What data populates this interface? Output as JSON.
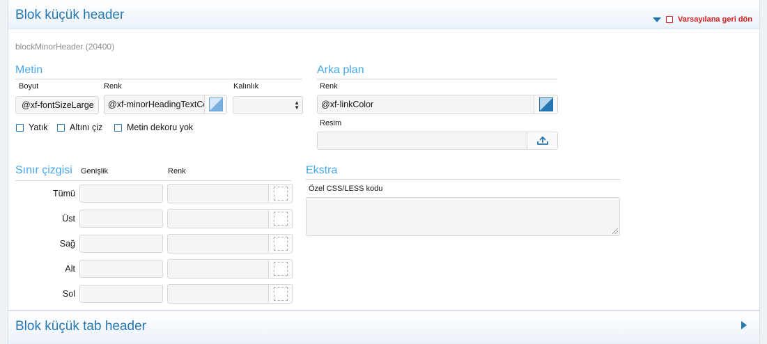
{
  "top_block": {
    "title": "Blok küçük header",
    "reset_label": "Varsayılana geri dön",
    "subtitle": "blockMinorHeader (20400)"
  },
  "metin": {
    "title": "Metin",
    "size_label": "Boyut",
    "size_value": "@xf-fontSizeLarge",
    "color_label": "Renk",
    "color_value": "@xf-minorHeadingTextColor",
    "weight_label": "Kalınlık",
    "weight_value": "",
    "checkboxes": [
      "Yatık",
      "Altını çiz",
      "Metin dekoru yok"
    ]
  },
  "arka_plan": {
    "title": "Arka plan",
    "color_label": "Renk",
    "color_value": "@xf-linkColor",
    "image_label": "Resim",
    "image_value": ""
  },
  "sinir": {
    "title": "Sınır çizgisi",
    "width_header": "Genişlik",
    "color_header": "Renk",
    "rows": [
      "Tümü",
      "Üst",
      "Sağ",
      "Alt",
      "Sol"
    ]
  },
  "ekstra": {
    "title": "Ekstra",
    "css_label": "Özel CSS/LESS kodu",
    "css_value": ""
  },
  "bottom_block": {
    "title": "Blok küçük tab header"
  },
  "colors": {
    "accent": "#2577b1",
    "section_heading": "#47a7eb",
    "reset_red": "#d71c1c"
  }
}
